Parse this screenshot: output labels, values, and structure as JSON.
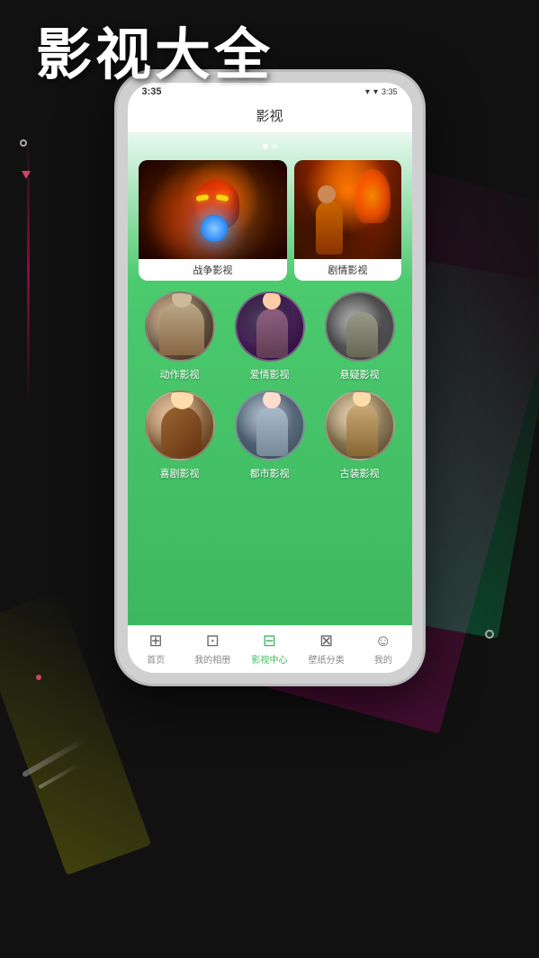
{
  "app": {
    "title": "影视大全",
    "screen_title": "影视"
  },
  "status_bar": {
    "time": "3:35",
    "signal": "▂▄▆",
    "wifi": "WiFi",
    "battery": "■■"
  },
  "featured": {
    "cards": [
      {
        "id": "war",
        "label": "战争影视",
        "size": "large"
      },
      {
        "id": "drama",
        "label": "剧情影视",
        "size": "small"
      }
    ]
  },
  "categories": [
    {
      "id": "action",
      "label": "动作影视",
      "circle_class": "action-circle"
    },
    {
      "id": "romance",
      "label": "爱情影视",
      "circle_class": "romance-circle"
    },
    {
      "id": "suspense",
      "label": "悬疑影视",
      "circle_class": "suspense-circle"
    },
    {
      "id": "comedy",
      "label": "喜剧影视",
      "circle_class": "comedy-circle"
    },
    {
      "id": "urban",
      "label": "都市影视",
      "circle_class": "urban-circle"
    },
    {
      "id": "ancient",
      "label": "古装影视",
      "circle_class": "ancient-circle"
    }
  ],
  "nav": {
    "items": [
      {
        "id": "home",
        "label": "首页",
        "icon": "⊞",
        "active": false
      },
      {
        "id": "album",
        "label": "我的相册",
        "icon": "⊡",
        "active": false
      },
      {
        "id": "movies",
        "label": "影视中心",
        "icon": "⊟",
        "active": true
      },
      {
        "id": "wallpaper",
        "label": "壁纸分类",
        "icon": "⊠",
        "active": false
      },
      {
        "id": "mine",
        "label": "我的",
        "icon": "☺",
        "active": false
      }
    ]
  }
}
